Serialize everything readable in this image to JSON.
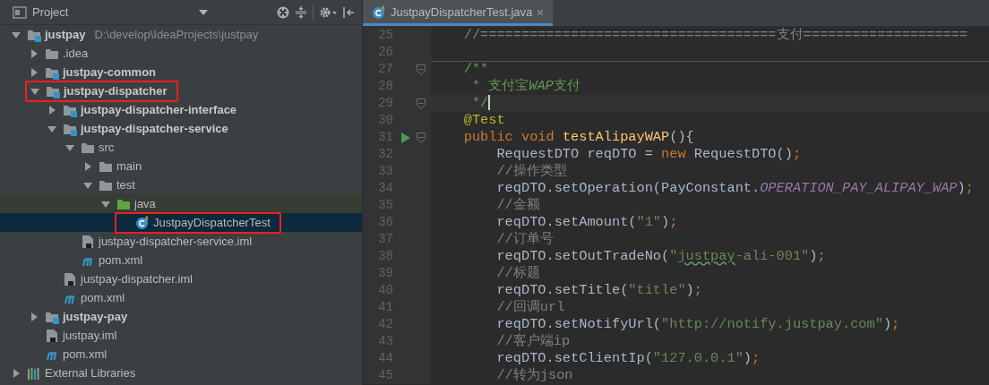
{
  "project_panel": {
    "title": "Project",
    "tree": [
      {
        "label": "justpay",
        "path": "D:\\develop\\IdeaProjects\\justpay",
        "kind": "module",
        "expanded": true,
        "selected": false,
        "marked": false,
        "children": [
          {
            "label": ".idea",
            "kind": "folder",
            "expanded": false,
            "selected": false,
            "marked": false
          },
          {
            "label": "justpay-common",
            "kind": "module",
            "expanded": false,
            "selected": false,
            "marked": false
          },
          {
            "label": "justpay-dispatcher",
            "kind": "module",
            "expanded": true,
            "selected": false,
            "marked": true,
            "children": [
              {
                "label": "justpay-dispatcher-interface",
                "kind": "module",
                "expanded": false,
                "selected": false,
                "marked": false
              },
              {
                "label": "justpay-dispatcher-service",
                "kind": "module",
                "expanded": true,
                "selected": false,
                "marked": false,
                "children": [
                  {
                    "label": "src",
                    "kind": "folder",
                    "expanded": true,
                    "selected": false,
                    "marked": false,
                    "children": [
                      {
                        "label": "main",
                        "kind": "folder",
                        "expanded": false,
                        "selected": false,
                        "marked": false
                      },
                      {
                        "label": "test",
                        "kind": "folder",
                        "expanded": true,
                        "selected": false,
                        "marked": false,
                        "children": [
                          {
                            "label": "java",
                            "kind": "test_root",
                            "expanded": true,
                            "selected": false,
                            "marked": false,
                            "children": [
                              {
                                "label": "JustpayDispatcherTest",
                                "kind": "test_class",
                                "selected": true,
                                "marked": true
                              }
                            ]
                          }
                        ]
                      }
                    ]
                  },
                  {
                    "label": "justpay-dispatcher-service.iml",
                    "kind": "iml",
                    "selected": false,
                    "marked": false
                  },
                  {
                    "label": "pom.xml",
                    "kind": "maven",
                    "selected": false,
                    "marked": false
                  }
                ]
              },
              {
                "label": "justpay-dispatcher.iml",
                "kind": "iml",
                "selected": false,
                "marked": false
              },
              {
                "label": "pom.xml",
                "kind": "maven",
                "selected": false,
                "marked": false
              }
            ]
          },
          {
            "label": "justpay-pay",
            "kind": "module",
            "expanded": false,
            "selected": false,
            "marked": false
          },
          {
            "label": "justpay.iml",
            "kind": "iml",
            "selected": false,
            "marked": false
          },
          {
            "label": "pom.xml",
            "kind": "maven",
            "selected": false,
            "marked": false
          }
        ]
      },
      {
        "label": "External Libraries",
        "kind": "libraries",
        "expanded": false,
        "selected": false,
        "marked": false
      }
    ]
  },
  "editor": {
    "tabs": [
      {
        "label": "JustpayDispatcherTest.java",
        "selected": true
      }
    ],
    "lines": [
      {
        "number": "25",
        "current": false,
        "separator_above": false,
        "fold": false,
        "run": false,
        "tokens": [
          {
            "kind": "comment",
            "text": "    //====================================支付===================="
          }
        ]
      },
      {
        "number": "26",
        "current": false,
        "separator_above": false,
        "fold": false,
        "run": false
      },
      {
        "number": "27",
        "current": false,
        "separator_above": true,
        "fold": true,
        "run": false,
        "tokens": [
          {
            "kind": "doc",
            "text": "    /**"
          }
        ]
      },
      {
        "number": "28",
        "current": false,
        "separator_above": false,
        "fold": false,
        "run": false,
        "tokens": [
          {
            "kind": "doc",
            "text": "     * 支付宝"
          },
          {
            "kind": "doc_italic",
            "text": "WAP"
          },
          {
            "kind": "doc",
            "text": "支付"
          }
        ]
      },
      {
        "number": "29",
        "current": true,
        "separator_above": false,
        "fold": true,
        "run": false,
        "tokens": [
          {
            "kind": "doc",
            "text": "     */"
          }
        ]
      },
      {
        "number": "30",
        "current": false,
        "separator_above": false,
        "fold": false,
        "run": false,
        "tokens": [
          {
            "kind": "annotation",
            "text": "    @Test"
          }
        ]
      },
      {
        "number": "31",
        "current": false,
        "separator_above": false,
        "fold": true,
        "run": true,
        "tokens": [
          {
            "kind": "keyword",
            "text": "    public void "
          },
          {
            "kind": "method",
            "text": "testAlipayWAP"
          },
          {
            "kind": "plain",
            "text": "(){"
          }
        ]
      },
      {
        "number": "32",
        "current": false,
        "separator_above": false,
        "fold": false,
        "run": false,
        "tokens": [
          {
            "kind": "plain",
            "text": "        RequestDTO reqDTO = "
          },
          {
            "kind": "keyword",
            "text": "new "
          },
          {
            "kind": "plain",
            "text": "RequestDTO()"
          },
          {
            "kind": "keyword",
            "text": ";"
          }
        ]
      },
      {
        "number": "33",
        "current": false,
        "separator_above": false,
        "fold": false,
        "run": false,
        "tokens": [
          {
            "kind": "comment",
            "text": "        //操作类型"
          }
        ]
      },
      {
        "number": "34",
        "current": false,
        "separator_above": false,
        "fold": false,
        "run": false,
        "tokens": [
          {
            "kind": "plain",
            "text": "        reqDTO.setOperation(PayConstant."
          },
          {
            "kind": "constant",
            "text": "OPERATION_PAY_ALIPAY_WAP"
          },
          {
            "kind": "plain",
            "text": ")"
          },
          {
            "kind": "keyword",
            "text": ";"
          }
        ]
      },
      {
        "number": "35",
        "current": false,
        "separator_above": false,
        "fold": false,
        "run": false,
        "tokens": [
          {
            "kind": "comment",
            "text": "        //金额"
          }
        ]
      },
      {
        "number": "36",
        "current": false,
        "separator_above": false,
        "fold": false,
        "run": false,
        "tokens": [
          {
            "kind": "plain",
            "text": "        reqDTO.setAmount("
          },
          {
            "kind": "string",
            "text": "\"1\""
          },
          {
            "kind": "plain",
            "text": ")"
          },
          {
            "kind": "keyword",
            "text": ";"
          }
        ]
      },
      {
        "number": "37",
        "current": false,
        "separator_above": false,
        "fold": false,
        "run": false,
        "tokens": [
          {
            "kind": "comment",
            "text": "        //订单号"
          }
        ]
      },
      {
        "number": "38",
        "current": false,
        "separator_above": false,
        "fold": false,
        "run": false,
        "tokens": [
          {
            "kind": "plain",
            "text": "        reqDTO.setOutTradeNo("
          },
          {
            "kind": "string",
            "text": "\""
          },
          {
            "kind": "typo_string",
            "text": "justpay"
          },
          {
            "kind": "string",
            "text": "-ali-001\""
          },
          {
            "kind": "plain",
            "text": ")"
          },
          {
            "kind": "keyword",
            "text": ";"
          }
        ]
      },
      {
        "number": "39",
        "current": false,
        "separator_above": false,
        "fold": false,
        "run": false,
        "tokens": [
          {
            "kind": "comment",
            "text": "        //标题"
          }
        ]
      },
      {
        "number": "40",
        "current": false,
        "separator_above": false,
        "fold": false,
        "run": false,
        "tokens": [
          {
            "kind": "plain",
            "text": "        reqDTO.setTitle("
          },
          {
            "kind": "string",
            "text": "\"title\""
          },
          {
            "kind": "plain",
            "text": ")"
          },
          {
            "kind": "keyword",
            "text": ";"
          }
        ]
      },
      {
        "number": "41",
        "current": false,
        "separator_above": false,
        "fold": false,
        "run": false,
        "tokens": [
          {
            "kind": "comment",
            "text": "        //回调url"
          }
        ]
      },
      {
        "number": "42",
        "current": false,
        "separator_above": false,
        "fold": false,
        "run": false,
        "tokens": [
          {
            "kind": "plain",
            "text": "        reqDTO.setNotifyUrl("
          },
          {
            "kind": "string",
            "text": "\"http://notify.justpay.com\""
          },
          {
            "kind": "plain",
            "text": ")"
          },
          {
            "kind": "keyword",
            "text": ";"
          }
        ]
      },
      {
        "number": "43",
        "current": false,
        "separator_above": false,
        "fold": false,
        "run": false,
        "tokens": [
          {
            "kind": "comment",
            "text": "        //客户端ip"
          }
        ]
      },
      {
        "number": "44",
        "current": false,
        "separator_above": false,
        "fold": false,
        "run": false,
        "tokens": [
          {
            "kind": "plain",
            "text": "        reqDTO.setClientIp("
          },
          {
            "kind": "string",
            "text": "\"127.0.0.1\""
          },
          {
            "kind": "plain",
            "text": ")"
          },
          {
            "kind": "keyword",
            "text": ";"
          }
        ]
      },
      {
        "number": "45",
        "current": false,
        "separator_above": false,
        "fold": false,
        "run": false,
        "tokens": [
          {
            "kind": "comment",
            "text": "        //转为json"
          }
        ]
      }
    ]
  }
}
